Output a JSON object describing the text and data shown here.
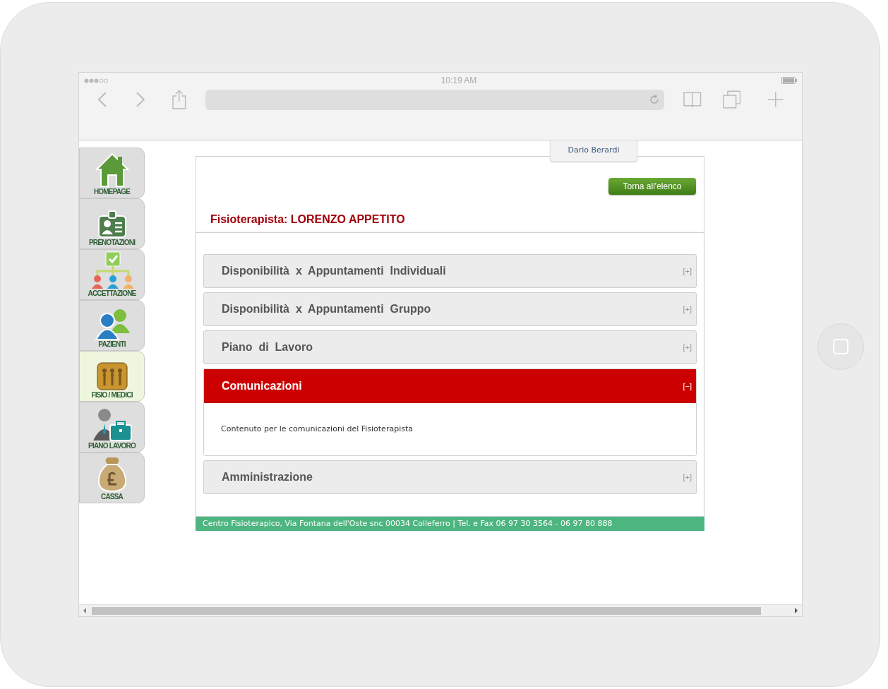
{
  "status_bar": {
    "time": "10:19 AM"
  },
  "sidebar": {
    "items": [
      {
        "label": "HOMEPAGE",
        "selected": false
      },
      {
        "label": "PRENOTAZIONI",
        "selected": false
      },
      {
        "label": "ACCETTAZIONE",
        "selected": false
      },
      {
        "label": "PAZIENTI",
        "selected": false
      },
      {
        "label": "FISIO / MEDICI",
        "selected": true
      },
      {
        "label": "PIANO LAVORO",
        "selected": false
      },
      {
        "label": "CASSA",
        "selected": false
      }
    ]
  },
  "user_tab": "Dario Berardi",
  "back_button": "Torna all'elenco",
  "title": "Fisioterapista: LORENZO APPETITO",
  "sections": [
    {
      "title": "Disponibilità  x  Appuntamenti  Individuali",
      "toggle": "[+]",
      "expanded": false
    },
    {
      "title": "Disponibilità  x  Appuntamenti  Gruppo",
      "toggle": "[+]",
      "expanded": false
    },
    {
      "title": "Piano  di  Lavoro",
      "toggle": "[+]",
      "expanded": false
    },
    {
      "title": "Comunicazioni",
      "toggle": "[−]",
      "expanded": true,
      "content": "Contenuto per le comunicazioni del Fisioterapista"
    },
    {
      "title": "Amministrazione",
      "toggle": "[+]",
      "expanded": false
    }
  ],
  "footer": "Centro Fisioterapico, Via Fontana dell'Oste snc 00034 Colleferro | Tel. e Fax 06 97 30 3564 - 06 97 80 888"
}
